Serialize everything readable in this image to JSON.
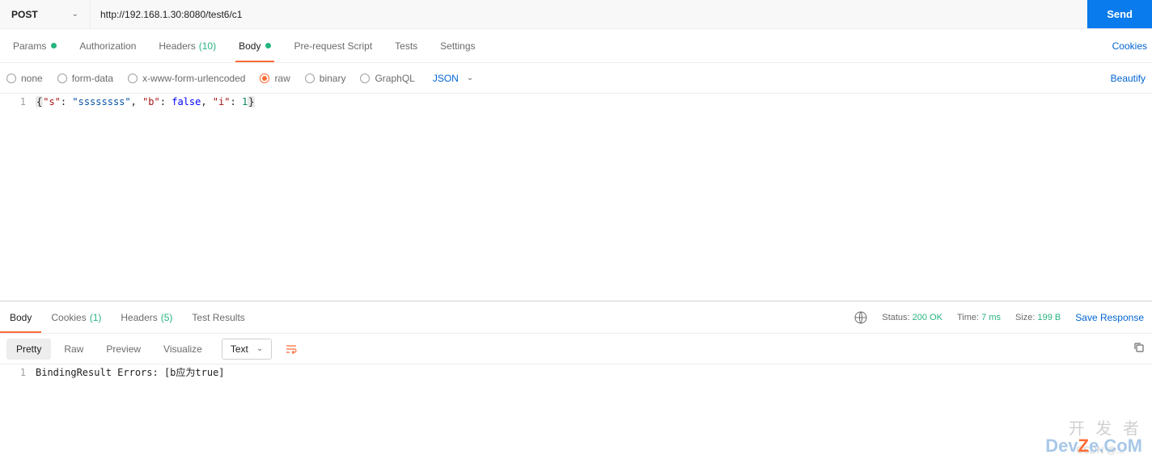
{
  "request": {
    "method": "POST",
    "url": "http://192.168.1.30:8080/test6/c1",
    "send_label": "Send"
  },
  "tabs": {
    "params": "Params",
    "auth": "Authorization",
    "headers": "Headers",
    "headers_count": "(10)",
    "body": "Body",
    "prereq": "Pre-request Script",
    "tests": "Tests",
    "settings": "Settings",
    "cookies_link": "Cookies"
  },
  "body_types": {
    "none": "none",
    "form": "form-data",
    "urlenc": "x-www-form-urlencoded",
    "raw": "raw",
    "binary": "binary",
    "graphql": "GraphQL",
    "raw_type": "JSON",
    "beautify": "Beautify"
  },
  "editor": {
    "line_num": "1",
    "json_key_s": "\"s\"",
    "json_val_s": "\"ssssssss\"",
    "json_key_b": "\"b\"",
    "json_val_b": "false",
    "json_key_i": "\"i\"",
    "json_val_i": "1"
  },
  "response": {
    "tabs": {
      "body": "Body",
      "cookies": "Cookies",
      "cookies_count": "(1)",
      "headers": "Headers",
      "headers_count": "(5)",
      "tests": "Test Results"
    },
    "status_label": "Status:",
    "status_value": "200 OK",
    "time_label": "Time:",
    "time_value": "7 ms",
    "size_label": "Size:",
    "size_value": "199 B",
    "save_link": "Save Response",
    "views": {
      "pretty": "Pretty",
      "raw": "Raw",
      "preview": "Preview",
      "visualize": "Visualize",
      "type": "Text"
    },
    "body_line_num": "1",
    "body_text": "BindingResult Errors: [b应为true]"
  },
  "watermark": {
    "cn": "开 发 者",
    "dev_pre": "Dev",
    "dev_z": "Z",
    "dev_post": "e.CoM",
    "csdn": "CSDN @..."
  }
}
